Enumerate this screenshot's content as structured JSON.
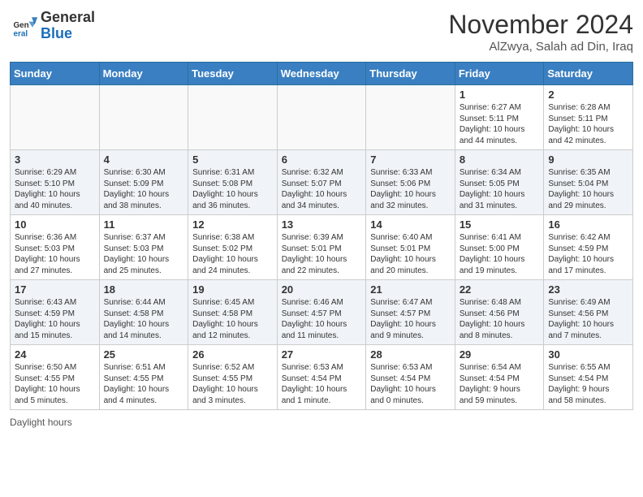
{
  "header": {
    "logo_general": "General",
    "logo_blue": "Blue",
    "month_title": "November 2024",
    "location": "AlZwya, Salah ad Din, Iraq"
  },
  "days_of_week": [
    "Sunday",
    "Monday",
    "Tuesday",
    "Wednesday",
    "Thursday",
    "Friday",
    "Saturday"
  ],
  "weeks": [
    [
      {
        "day": "",
        "info": ""
      },
      {
        "day": "",
        "info": ""
      },
      {
        "day": "",
        "info": ""
      },
      {
        "day": "",
        "info": ""
      },
      {
        "day": "",
        "info": ""
      },
      {
        "day": "1",
        "info": "Sunrise: 6:27 AM\nSunset: 5:11 PM\nDaylight: 10 hours\nand 44 minutes."
      },
      {
        "day": "2",
        "info": "Sunrise: 6:28 AM\nSunset: 5:11 PM\nDaylight: 10 hours\nand 42 minutes."
      }
    ],
    [
      {
        "day": "3",
        "info": "Sunrise: 6:29 AM\nSunset: 5:10 PM\nDaylight: 10 hours\nand 40 minutes."
      },
      {
        "day": "4",
        "info": "Sunrise: 6:30 AM\nSunset: 5:09 PM\nDaylight: 10 hours\nand 38 minutes."
      },
      {
        "day": "5",
        "info": "Sunrise: 6:31 AM\nSunset: 5:08 PM\nDaylight: 10 hours\nand 36 minutes."
      },
      {
        "day": "6",
        "info": "Sunrise: 6:32 AM\nSunset: 5:07 PM\nDaylight: 10 hours\nand 34 minutes."
      },
      {
        "day": "7",
        "info": "Sunrise: 6:33 AM\nSunset: 5:06 PM\nDaylight: 10 hours\nand 32 minutes."
      },
      {
        "day": "8",
        "info": "Sunrise: 6:34 AM\nSunset: 5:05 PM\nDaylight: 10 hours\nand 31 minutes."
      },
      {
        "day": "9",
        "info": "Sunrise: 6:35 AM\nSunset: 5:04 PM\nDaylight: 10 hours\nand 29 minutes."
      }
    ],
    [
      {
        "day": "10",
        "info": "Sunrise: 6:36 AM\nSunset: 5:03 PM\nDaylight: 10 hours\nand 27 minutes."
      },
      {
        "day": "11",
        "info": "Sunrise: 6:37 AM\nSunset: 5:03 PM\nDaylight: 10 hours\nand 25 minutes."
      },
      {
        "day": "12",
        "info": "Sunrise: 6:38 AM\nSunset: 5:02 PM\nDaylight: 10 hours\nand 24 minutes."
      },
      {
        "day": "13",
        "info": "Sunrise: 6:39 AM\nSunset: 5:01 PM\nDaylight: 10 hours\nand 22 minutes."
      },
      {
        "day": "14",
        "info": "Sunrise: 6:40 AM\nSunset: 5:01 PM\nDaylight: 10 hours\nand 20 minutes."
      },
      {
        "day": "15",
        "info": "Sunrise: 6:41 AM\nSunset: 5:00 PM\nDaylight: 10 hours\nand 19 minutes."
      },
      {
        "day": "16",
        "info": "Sunrise: 6:42 AM\nSunset: 4:59 PM\nDaylight: 10 hours\nand 17 minutes."
      }
    ],
    [
      {
        "day": "17",
        "info": "Sunrise: 6:43 AM\nSunset: 4:59 PM\nDaylight: 10 hours\nand 15 minutes."
      },
      {
        "day": "18",
        "info": "Sunrise: 6:44 AM\nSunset: 4:58 PM\nDaylight: 10 hours\nand 14 minutes."
      },
      {
        "day": "19",
        "info": "Sunrise: 6:45 AM\nSunset: 4:58 PM\nDaylight: 10 hours\nand 12 minutes."
      },
      {
        "day": "20",
        "info": "Sunrise: 6:46 AM\nSunset: 4:57 PM\nDaylight: 10 hours\nand 11 minutes."
      },
      {
        "day": "21",
        "info": "Sunrise: 6:47 AM\nSunset: 4:57 PM\nDaylight: 10 hours\nand 9 minutes."
      },
      {
        "day": "22",
        "info": "Sunrise: 6:48 AM\nSunset: 4:56 PM\nDaylight: 10 hours\nand 8 minutes."
      },
      {
        "day": "23",
        "info": "Sunrise: 6:49 AM\nSunset: 4:56 PM\nDaylight: 10 hours\nand 7 minutes."
      }
    ],
    [
      {
        "day": "24",
        "info": "Sunrise: 6:50 AM\nSunset: 4:55 PM\nDaylight: 10 hours\nand 5 minutes."
      },
      {
        "day": "25",
        "info": "Sunrise: 6:51 AM\nSunset: 4:55 PM\nDaylight: 10 hours\nand 4 minutes."
      },
      {
        "day": "26",
        "info": "Sunrise: 6:52 AM\nSunset: 4:55 PM\nDaylight: 10 hours\nand 3 minutes."
      },
      {
        "day": "27",
        "info": "Sunrise: 6:53 AM\nSunset: 4:54 PM\nDaylight: 10 hours\nand 1 minute."
      },
      {
        "day": "28",
        "info": "Sunrise: 6:53 AM\nSunset: 4:54 PM\nDaylight: 10 hours\nand 0 minutes."
      },
      {
        "day": "29",
        "info": "Sunrise: 6:54 AM\nSunset: 4:54 PM\nDaylight: 9 hours\nand 59 minutes."
      },
      {
        "day": "30",
        "info": "Sunrise: 6:55 AM\nSunset: 4:54 PM\nDaylight: 9 hours\nand 58 minutes."
      }
    ]
  ],
  "footer": {
    "note": "Daylight hours"
  }
}
